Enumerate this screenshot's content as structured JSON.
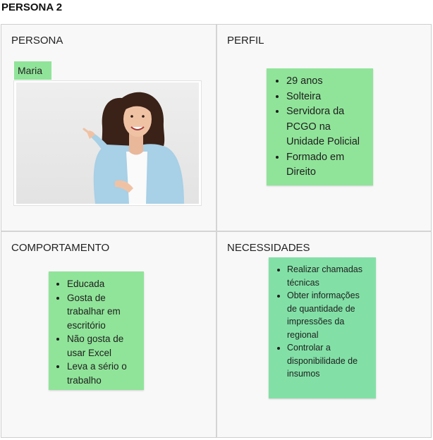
{
  "board": {
    "title": "PERSONA 2"
  },
  "persona": {
    "title": "PERSONA",
    "name": "Maria"
  },
  "perfil": {
    "title": "PERFIL",
    "items": [
      "29 anos",
      "Solteira",
      "Servidora da PCGO na Unidade Policial",
      "Formado em Direito"
    ]
  },
  "comportamento": {
    "title": "COMPORTAMENTO",
    "items": [
      "Educada",
      "Gosta de trabalhar em escritório",
      "Não gosta de usar Excel",
      "Leva a sério o trabalho"
    ]
  },
  "necessidades": {
    "title": "NECESSIDADES",
    "items": [
      "Realizar chamadas técnicas",
      "Obter informações de quantidade de impressões da regional",
      "Controlar a disponibilidade de insumos"
    ]
  },
  "colors": {
    "sticky_note": "#90e499",
    "sticky_note_alt": "#82e0a6",
    "frame_bg": "#f8f8f8"
  }
}
